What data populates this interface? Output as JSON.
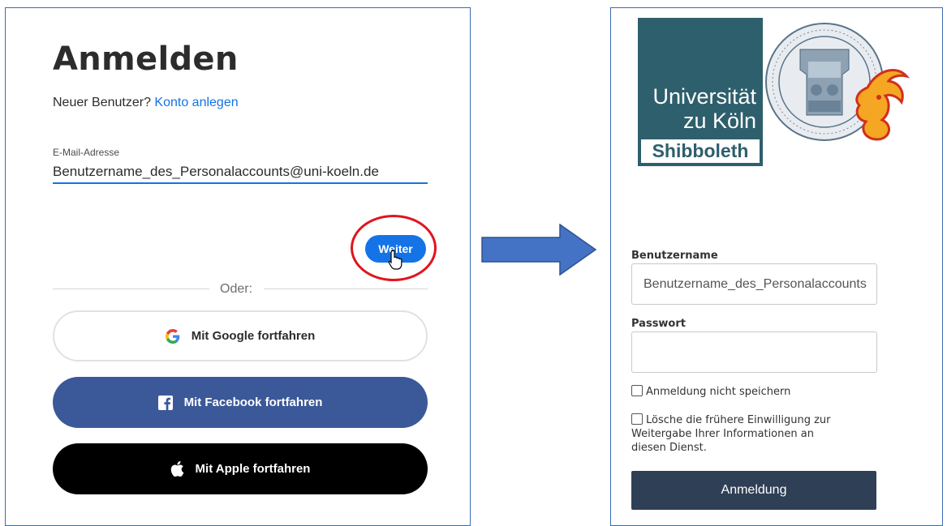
{
  "left": {
    "title": "Anmelden",
    "new_user_prefix": "Neuer Benutzer?",
    "create_account_link": "Konto anlegen",
    "email_label": "E-Mail-Adresse",
    "email_value": "Benutzername_des_Personalaccounts@uni-koeln.de",
    "continue_label": "Weiter",
    "divider_text": "Oder:",
    "google_label": "Mit Google fortfahren",
    "facebook_label": "Mit Facebook fortfahren",
    "apple_label": "Mit Apple fortfahren"
  },
  "right": {
    "logo_line1": "Universität",
    "logo_line2": "zu Köln",
    "logo_shibboleth": "Shibboleth",
    "username_label": "Benutzername",
    "username_value": "Benutzername_des_Personalaccounts",
    "password_label": "Passwort",
    "password_value": "",
    "checkbox1_label": "Anmeldung nicht speichern",
    "checkbox2_label": "Lösche die frühere Einwilligung zur Weitergabe Ihrer Informationen an diesen Dienst.",
    "login_label": "Anmeldung"
  },
  "colors": {
    "adobe_blue": "#1473e6",
    "facebook_blue": "#3b5998",
    "highlight_red": "#e0141e",
    "uni_teal": "#2e5f6c",
    "login_dark": "#2f3f55"
  },
  "icons": [
    "google-icon",
    "facebook-icon",
    "apple-icon",
    "hand-cursor-icon",
    "right-arrow-icon",
    "university-seal-icon"
  ]
}
